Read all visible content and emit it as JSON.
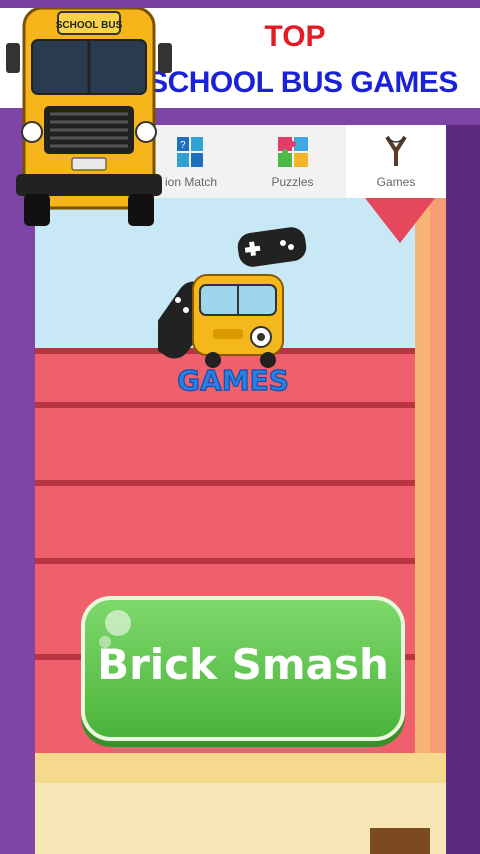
{
  "header": {
    "title_line1": "TOP",
    "title_line2": "SCHOOL BUS GAMES"
  },
  "logo": {
    "sign_text": "SCHOOL BUS"
  },
  "tabs": [
    {
      "label": "ion Match",
      "icon": "question-grid-icon",
      "active": false
    },
    {
      "label": "Puzzles",
      "icon": "puzzle-icon",
      "active": false
    },
    {
      "label": "Games",
      "icon": "slingshot-icon",
      "active": true
    }
  ],
  "games_logo": {
    "text": "GAMES"
  },
  "game_button": {
    "label": "Brick Smash"
  },
  "colors": {
    "background_purple": "#7e44a6",
    "title_red": "#e31b23",
    "title_blue": "#1a22d8",
    "button_green": "#5cc548",
    "brick_red": "#ef5f6c"
  }
}
